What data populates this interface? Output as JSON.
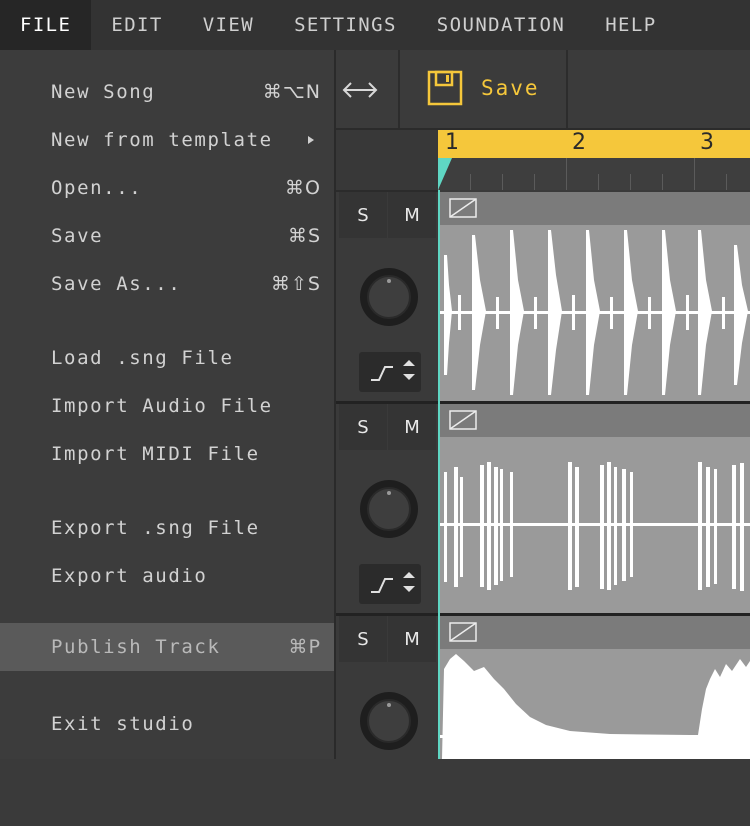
{
  "menubar": {
    "items": [
      {
        "label": "FILE"
      },
      {
        "label": "EDIT"
      },
      {
        "label": "VIEW"
      },
      {
        "label": "SETTINGS"
      },
      {
        "label": "SOUNDATION"
      },
      {
        "label": "HELP"
      }
    ]
  },
  "toolbar": {
    "save_label": "Save",
    "swap_icon": "horizontal-arrows-icon",
    "save_icon": "floppy-disk-icon"
  },
  "timeline": {
    "bars": [
      "1",
      "2",
      "3"
    ]
  },
  "tracks": [
    {
      "solo_label": "S",
      "mute_label": "M"
    },
    {
      "solo_label": "S",
      "mute_label": "M"
    },
    {
      "solo_label": "S",
      "mute_label": "M"
    }
  ],
  "file_menu": {
    "items": [
      {
        "label": "New Song",
        "shortcut": "⌘⌥N"
      },
      {
        "label": "New from template",
        "shortcut": ""
      },
      {
        "label": "Open...",
        "shortcut": "⌘O"
      },
      {
        "label": "Save",
        "shortcut": "⌘S"
      },
      {
        "label": "Save As...",
        "shortcut": "⌘⇧S"
      },
      {
        "label": "Load .sng File",
        "shortcut": ""
      },
      {
        "label": "Import Audio File",
        "shortcut": ""
      },
      {
        "label": "Import MIDI File",
        "shortcut": ""
      },
      {
        "label": "Export .sng File",
        "shortcut": ""
      },
      {
        "label": "Export audio",
        "shortcut": ""
      },
      {
        "label": "Publish Track",
        "shortcut": "⌘P"
      },
      {
        "label": "Exit studio",
        "shortcut": ""
      }
    ]
  },
  "colors": {
    "accent": "#f5c73b",
    "playhead": "#5fd6c3",
    "clip": "#9a9a9a",
    "menu_bg": "#3c3c3c"
  }
}
